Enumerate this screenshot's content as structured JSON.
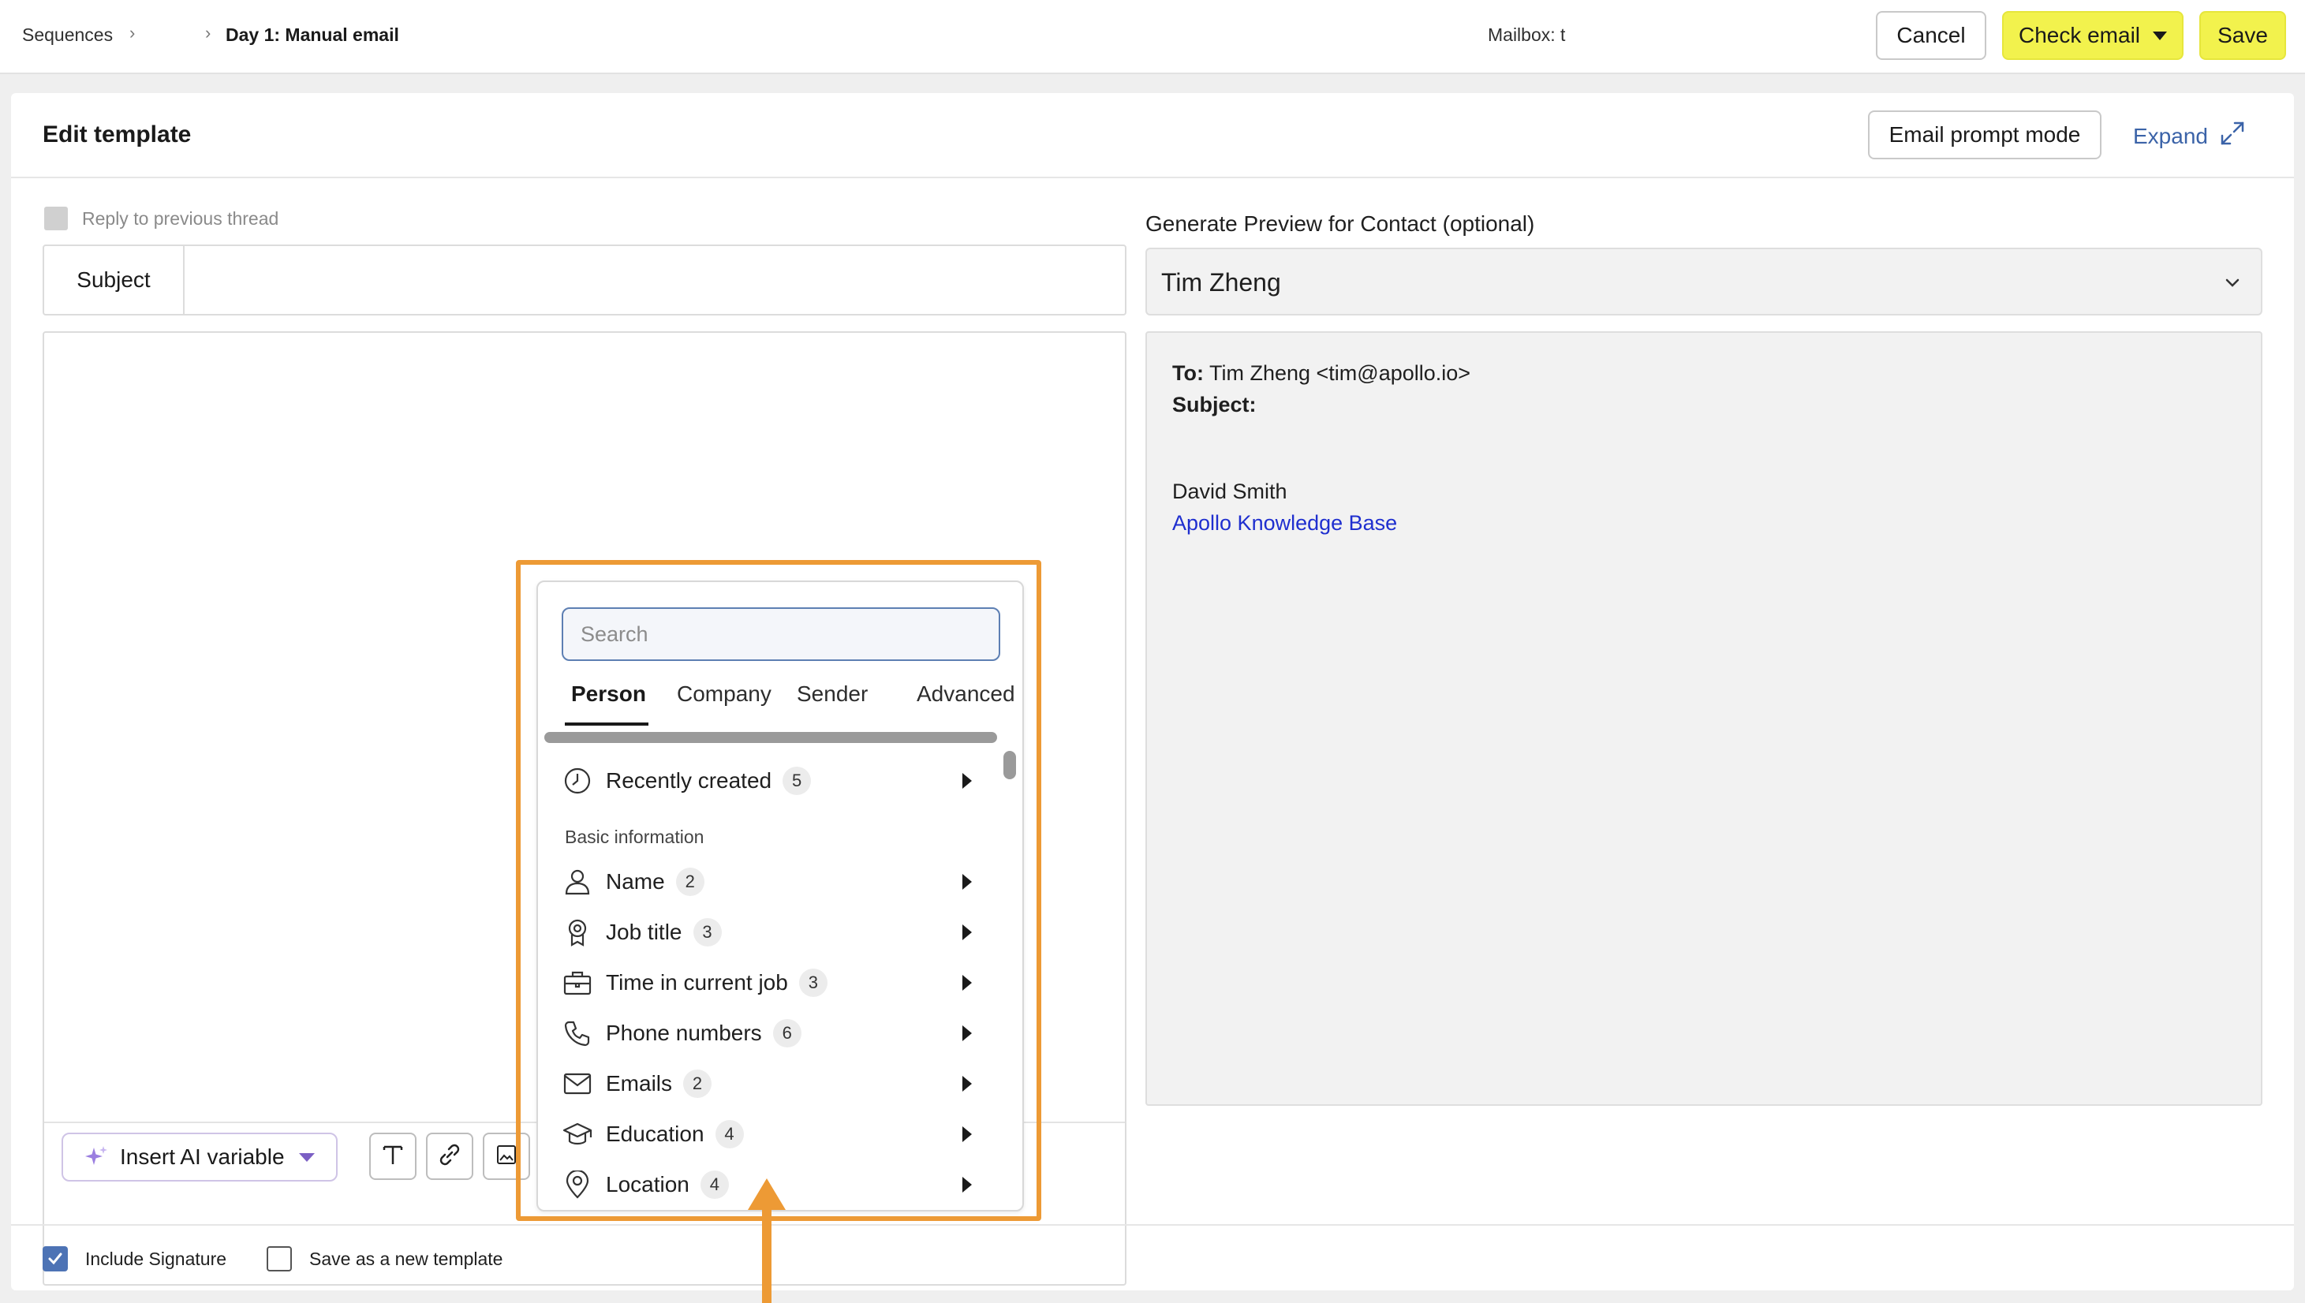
{
  "breadcrumb": {
    "root": "Sequences",
    "current": "Day 1: Manual email"
  },
  "mailbox_label": "Mailbox: t",
  "header_actions": {
    "cancel": "Cancel",
    "check_email": "Check email",
    "save": "Save"
  },
  "panel": {
    "title": "Edit template",
    "prompt_mode": "Email prompt mode",
    "expand": "Expand"
  },
  "editor": {
    "reply_to_thread": "Reply to previous thread",
    "subject_label": "Subject",
    "subject_value": "",
    "insert_ai_variable": "Insert AI variable"
  },
  "toolbar_tools": [
    "text-format-icon",
    "link-icon",
    "image-icon",
    "attachment-icon",
    "code-icon",
    "document-icon",
    "ai-robot-icon",
    "variables-braces-icon",
    "snippet-scissors-icon",
    "calendar-icon"
  ],
  "variables_dropdown": {
    "search_placeholder": "Search",
    "tabs": [
      "Person",
      "Company",
      "Sender",
      "Advanced"
    ],
    "active_tab": "Person",
    "recent": {
      "label": "Recently created",
      "count": "5",
      "icon": "clock-icon"
    },
    "section_title": "Basic information",
    "items": [
      {
        "label": "Name",
        "count": "2",
        "icon": "person-icon"
      },
      {
        "label": "Job title",
        "count": "3",
        "icon": "badge-icon"
      },
      {
        "label": "Time in current job",
        "count": "3",
        "icon": "briefcase-icon"
      },
      {
        "label": "Phone numbers",
        "count": "6",
        "icon": "phone-icon"
      },
      {
        "label": "Emails",
        "count": "2",
        "icon": "envelope-icon"
      },
      {
        "label": "Education",
        "count": "4",
        "icon": "graduation-cap-icon"
      },
      {
        "label": "Location",
        "count": "4",
        "icon": "location-pin-icon"
      }
    ]
  },
  "preview": {
    "label": "Generate Preview for Contact (optional)",
    "selected_contact": "Tim Zheng",
    "to_label": "To:",
    "to_value": "Tim Zheng <tim@apollo.io>",
    "subject_label": "Subject:",
    "signature_name": "David Smith",
    "signature_link": "Apollo Knowledge Base"
  },
  "footer": {
    "include_signature": "Include Signature",
    "include_signature_checked": true,
    "save_as_template": "Save as a new template",
    "save_as_template_checked": false
  },
  "colors": {
    "accent_yellow": "#f2f24d",
    "highlight_orange": "#ed9a35",
    "link_blue": "#1f2fcf",
    "checkbox_blue": "#4d73b5"
  }
}
